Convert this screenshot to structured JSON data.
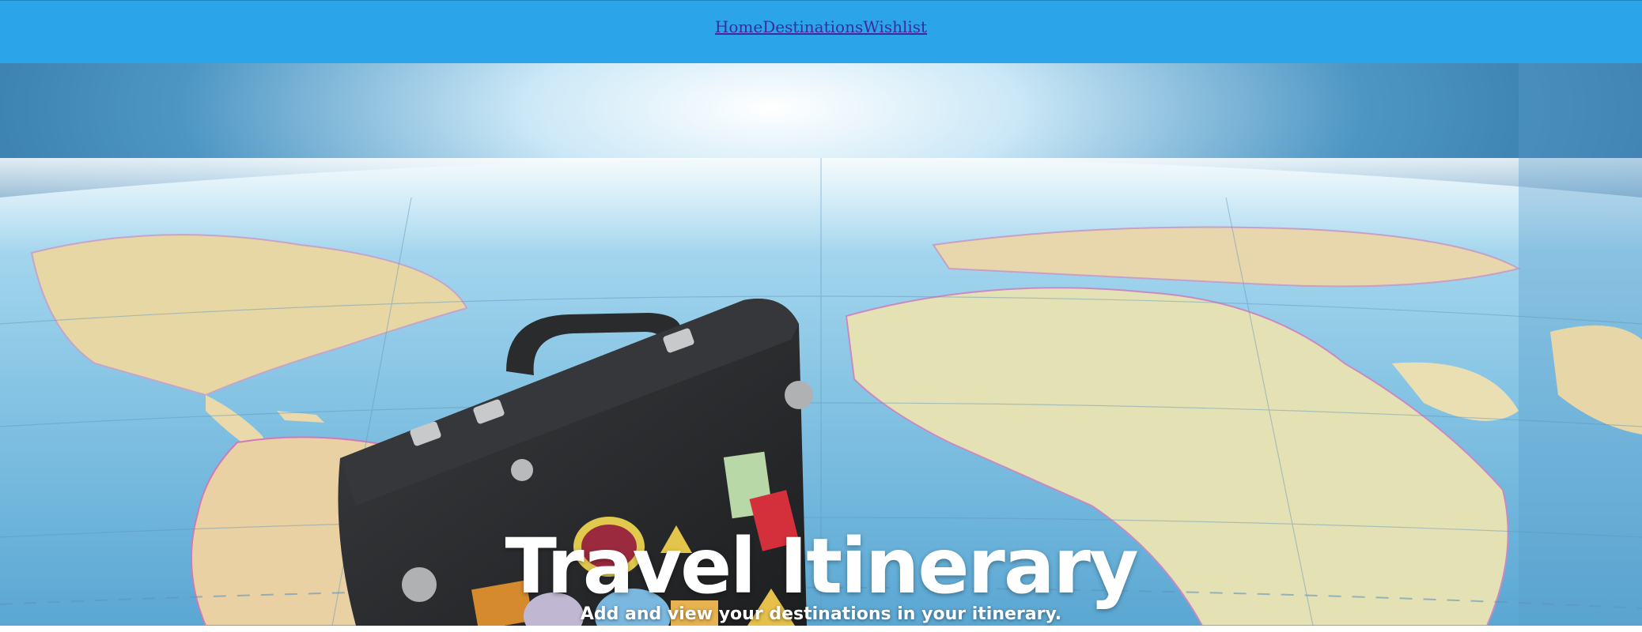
{
  "nav": {
    "links": [
      {
        "label": "Home"
      },
      {
        "label": "Destinations"
      },
      {
        "label": "Wishlist"
      }
    ]
  },
  "hero": {
    "title": "Travel Itinerary",
    "subtitle": "Add and view your destinations in your itinerary."
  },
  "colors": {
    "navbar": "#2ba4ea",
    "nav_link": "#3d2a9c",
    "ocean": "#6fb9de",
    "land": "#e8d9a8",
    "suitcase": "#2b2c2e",
    "hero_text": "#ffffff"
  },
  "icons": [
    "world-map-background",
    "suitcase-illustration"
  ]
}
